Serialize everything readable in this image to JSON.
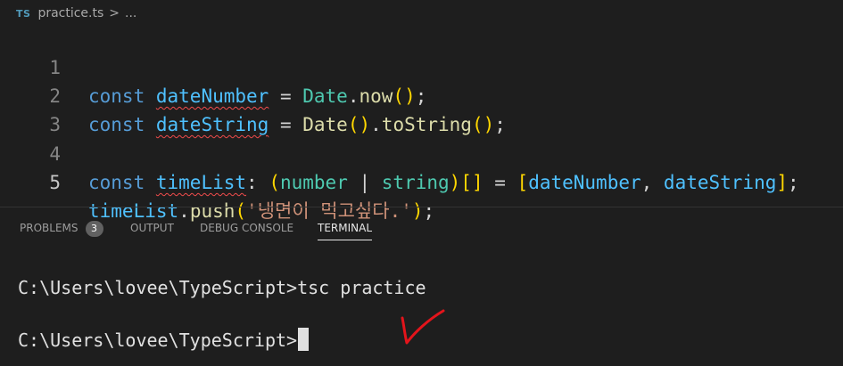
{
  "breadcrumb": {
    "lang_badge": "TS",
    "filename": "practice.ts",
    "separator": ">",
    "ellipsis": "..."
  },
  "editor": {
    "line_numbers": [
      "1",
      "2",
      "3",
      "4",
      "5"
    ],
    "active_line": "5",
    "lines": {
      "l1": {
        "kw": "const",
        "name": "dateNumber",
        "eq": " = ",
        "obj": "Date",
        "dot": ".",
        "method": "now",
        "open": "(",
        "close": ")",
        "end": ";"
      },
      "l2": {
        "kw": "const",
        "name": "dateString",
        "eq": " = ",
        "obj": "Date",
        "open1": "(",
        "close1": ")",
        "dot": ".",
        "method": "toString",
        "open2": "(",
        "close2": ")",
        "end": ";"
      },
      "l4": {
        "kw": "const",
        "name": "timeList",
        "colon": ": ",
        "open": "(",
        "t1": "number",
        "pipe": " | ",
        "t2": "string",
        "close": ")",
        "arr": "[]",
        "eq": " = ",
        "lb": "[",
        "a1": "dateNumber",
        "comma": ", ",
        "a2": "dateString",
        "rb": "]",
        "end": ";"
      },
      "l5": {
        "obj": "timeList",
        "dot": ".",
        "method": "push",
        "open": "(",
        "str": "'냉면이 먹고싶다.'",
        "close": ")",
        "end": ";"
      }
    }
  },
  "panel": {
    "tabs": [
      "PROBLEMS",
      "OUTPUT",
      "DEBUG CONSOLE",
      "TERMINAL"
    ],
    "problems_count": "3",
    "active_tab": "TERMINAL"
  },
  "terminal": {
    "line1": "C:\\Users\\lovee\\TypeScript>tsc practice",
    "line2": "C:\\Users\\lovee\\TypeScript>"
  },
  "annotation": {
    "color": "#e3141b",
    "icon": "red-checkmark-icon"
  }
}
